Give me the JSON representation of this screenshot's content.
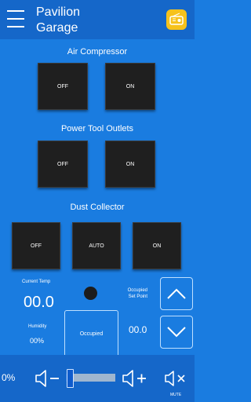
{
  "header": {
    "title_line1": "Pavilion",
    "title_line2": "Garage"
  },
  "air_compressor": {
    "title": "Air Compressor",
    "buttons": [
      "OFF",
      "ON"
    ]
  },
  "power_tool_outlets": {
    "title": "Power Tool Outlets",
    "buttons": [
      "OFF",
      "ON"
    ]
  },
  "dust_collector": {
    "title": "Dust Collector",
    "buttons": [
      "OFF",
      "AUTO",
      "ON"
    ]
  },
  "climate": {
    "current_temp_label": "Current Temp",
    "current_temp_value": "00.0",
    "humidity_label": "Humidity",
    "humidity_value": "00%",
    "occupied_button": "Occupied",
    "setpoint_label_line1": "Occupied",
    "setpoint_label_line2": "Set Point",
    "setpoint_value": "00.0"
  },
  "footer": {
    "volume_percent_text": "0%",
    "volume_level": 0.0,
    "mute_label": "MUTE"
  },
  "colors": {
    "background": "#1a7ce0",
    "header": "#1567c9",
    "tile": "#1f1f1f",
    "app_icon": "#f6c21c"
  },
  "icons": {
    "menu": "hamburger-icon",
    "app": "radio-app-icon",
    "status": "status-indicator-icon",
    "up": "chevron-up-icon",
    "down": "chevron-down-icon",
    "vol_down": "volume-down-icon",
    "vol_up": "volume-up-icon",
    "mute": "mute-icon"
  }
}
